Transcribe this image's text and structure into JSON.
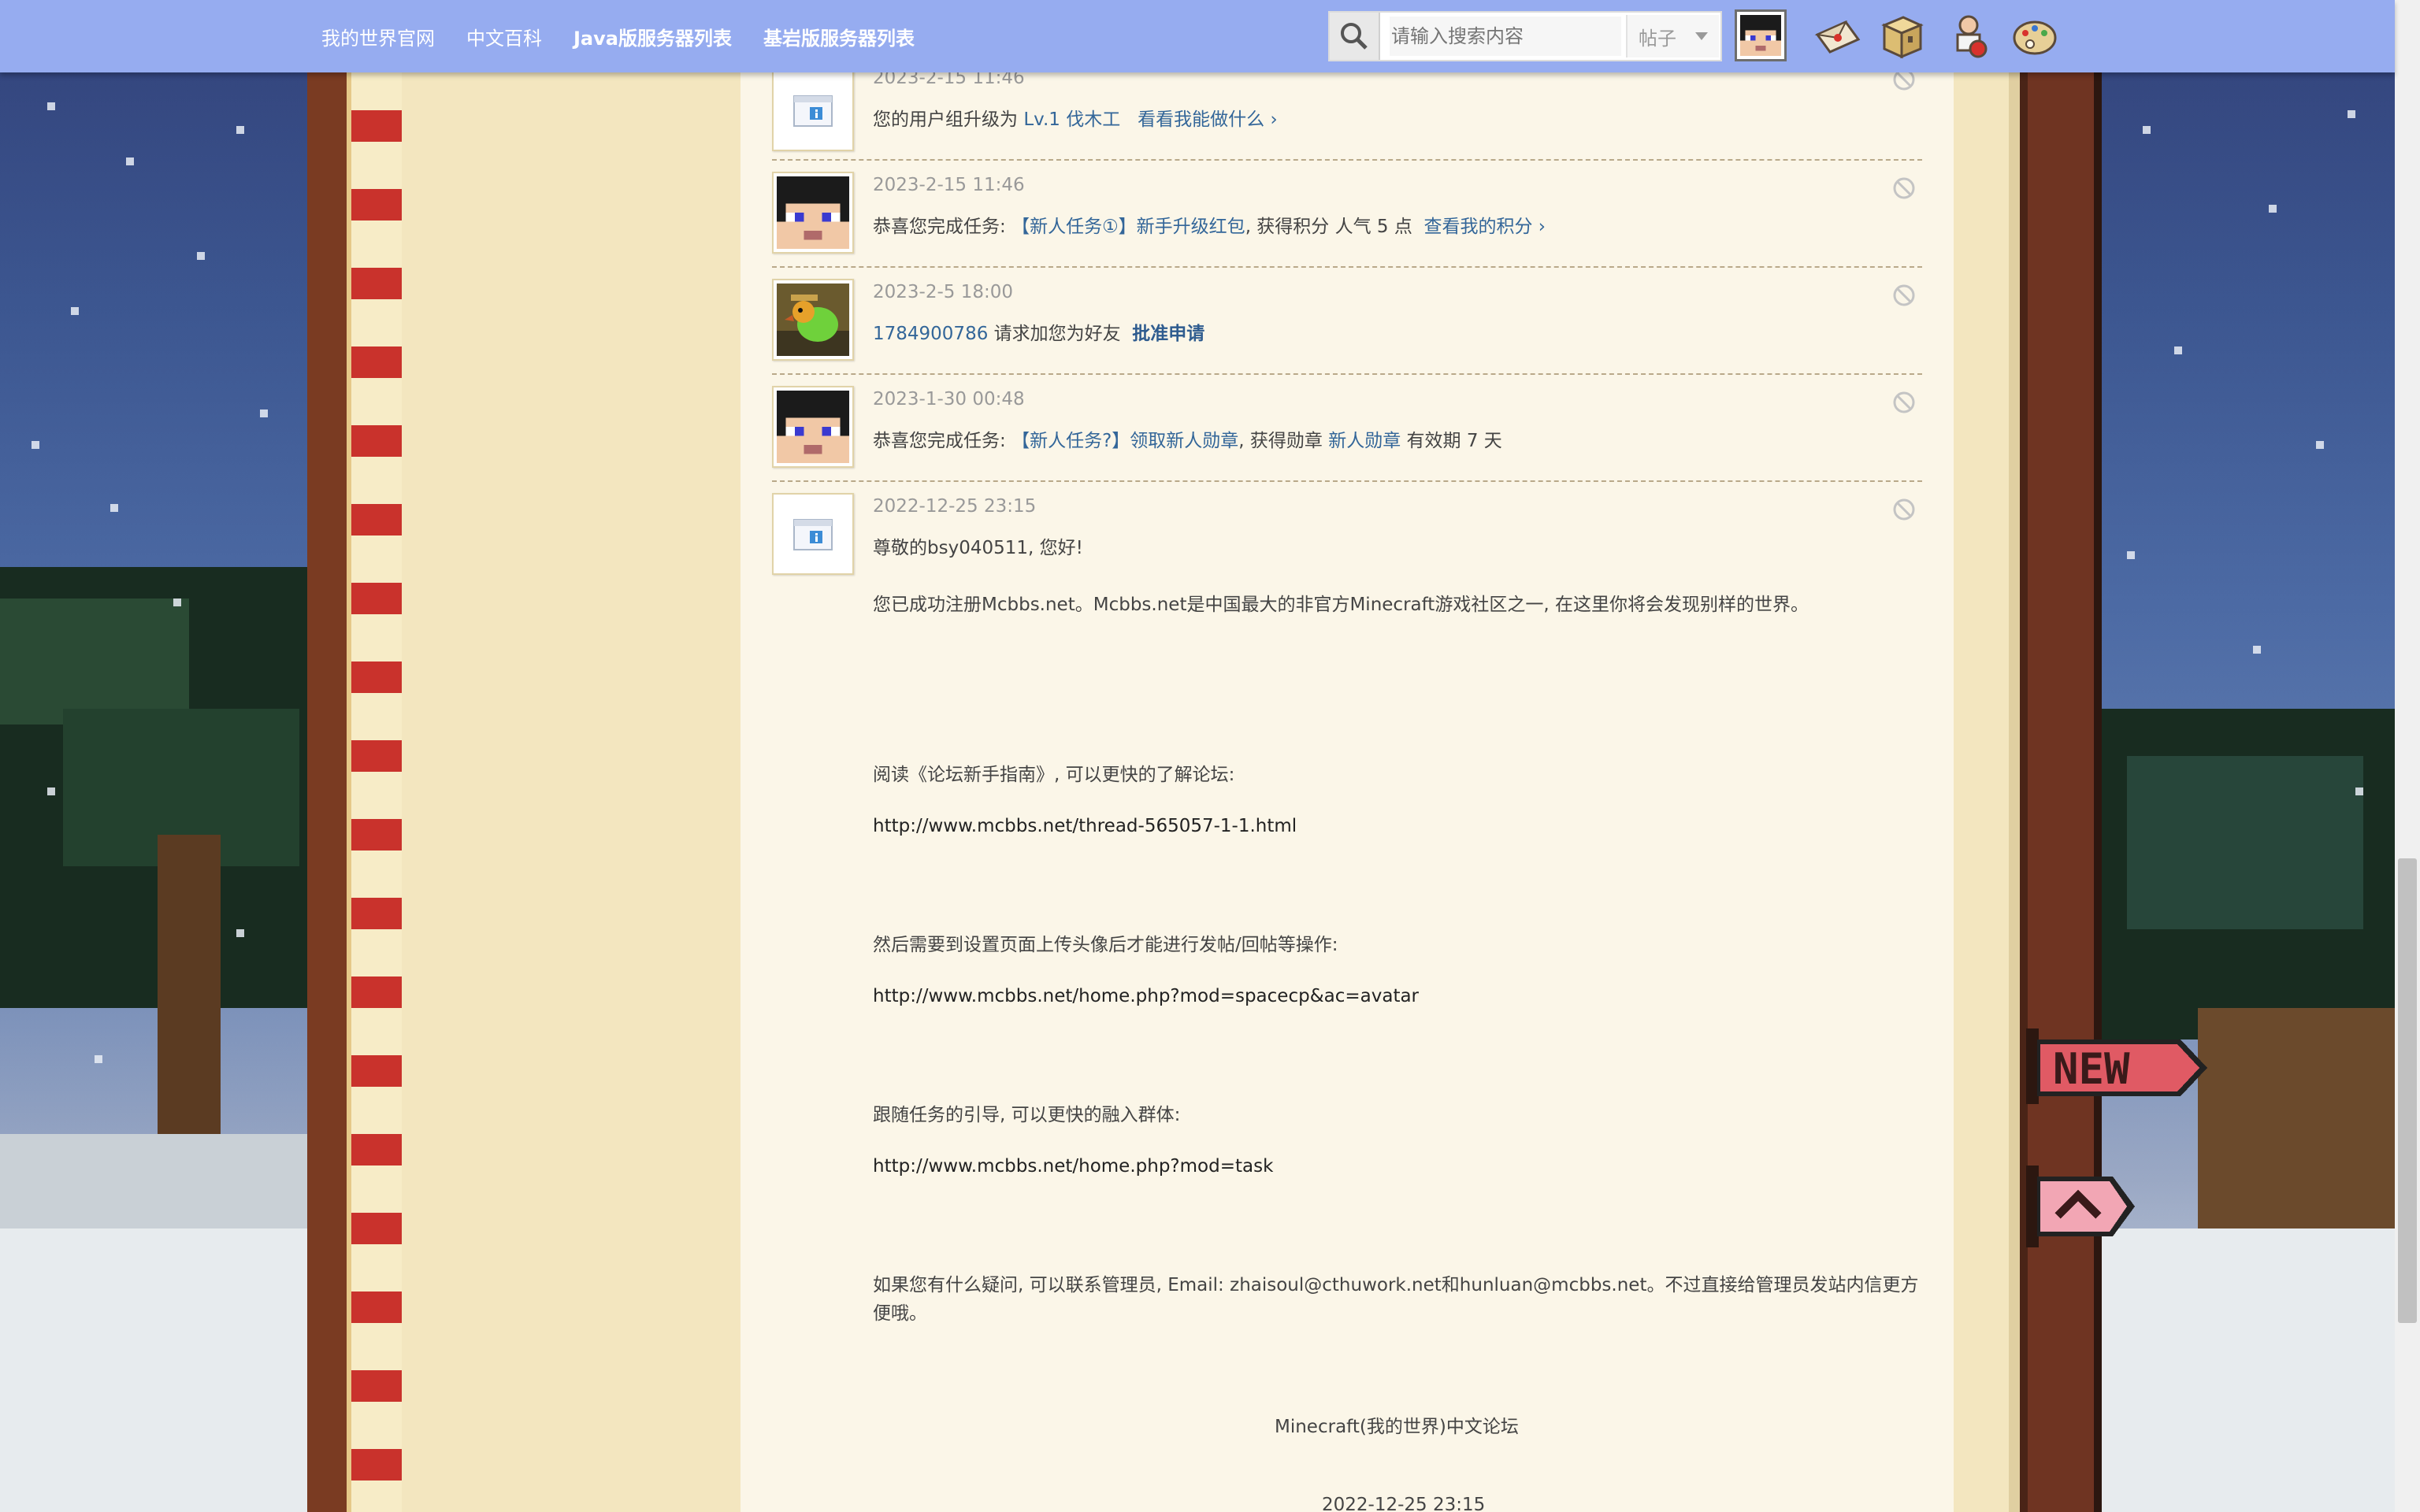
{
  "nav": {
    "items": [
      "我的世界官网",
      "中文百科",
      "Java版服务器列表",
      "基岩版服务器列表"
    ]
  },
  "search": {
    "placeholder": "请输入搜索内容",
    "scope": "帖子"
  },
  "top_icons": [
    "avatar",
    "mail-icon",
    "chest-icon",
    "potion-icon",
    "palette-icon"
  ],
  "notices": [
    {
      "time": "2023-2-15 11:46",
      "parts": [
        {
          "text": "您的用户组升级为 "
        },
        {
          "text": "Lv.1 伐木工",
          "link": true
        },
        {
          "text": "   "
        },
        {
          "text": "看看我能做什么 ›",
          "link": true
        }
      ],
      "avatar": "system-info-icon"
    },
    {
      "time": "2023-2-15 11:46",
      "parts": [
        {
          "text": "恭喜您完成任务: "
        },
        {
          "text": "【新人任务①】新手升级红包",
          "link": true
        },
        {
          "text": ", 获得积分 人气 5 点  "
        },
        {
          "text": "查看我的积分 ›",
          "link": true
        }
      ],
      "avatar": "steve-avatar"
    },
    {
      "time": "2023-2-5 18:00",
      "parts": [
        {
          "text": "1784900786",
          "link": true
        },
        {
          "text": " 请求加您为好友  "
        },
        {
          "text": "批准申请",
          "link": true,
          "bold": true
        }
      ],
      "avatar": "parrot-avatar"
    },
    {
      "time": "2023-1-30 00:48",
      "parts": [
        {
          "text": "恭喜您完成任务: "
        },
        {
          "text": "【新人任务?】领取新人勋章",
          "link": true
        },
        {
          "text": ", 获得勋章 "
        },
        {
          "text": "新人勋章",
          "link": true
        },
        {
          "text": " 有效期 7 天"
        }
      ],
      "avatar": "steve-avatar"
    },
    {
      "time": "2022-12-25 23:15",
      "parts": [
        {
          "text": "尊敬的bsy040511, 您好!"
        }
      ],
      "avatar": "system-info-icon"
    }
  ],
  "welcome": {
    "intro": "您已成功注册Mcbbs.net。Mcbbs.net是中国最大的非官方Minecraft游戏社区之一, 在这里你将会发现别样的世界。",
    "guide_label": "阅读《论坛新手指南》, 可以更快的了解论坛:",
    "guide_url": "http://www.mcbbs.net/thread-565057-1-1.html",
    "avatar_label": "然后需要到设置页面上传头像后才能进行发帖/回帖等操作:",
    "avatar_url": "http://www.mcbbs.net/home.php?mod=spacecp&ac=avatar",
    "task_label": "跟随任务的引导, 可以更快的融入群体:",
    "task_url": "http://www.mcbbs.net/home.php?mod=task",
    "contact_line1": "如果您有什么疑问, 可以联系管理员, Email: zhaisoul@cthuwork.net和hunluan@mcbbs.net。不过直接给管理员发站内信更方",
    "contact_line2": "便哦。",
    "signature": "Minecraft(我的世界)中文论坛",
    "date": "2022-12-25 23:15"
  },
  "side_badges": {
    "new_label": "NEW",
    "top_label": "back-to-top"
  },
  "colors": {
    "topbar": "#96acf0",
    "link": "#336699",
    "frame_brown": "#7a3b22",
    "paper": "#fbf6e8"
  }
}
